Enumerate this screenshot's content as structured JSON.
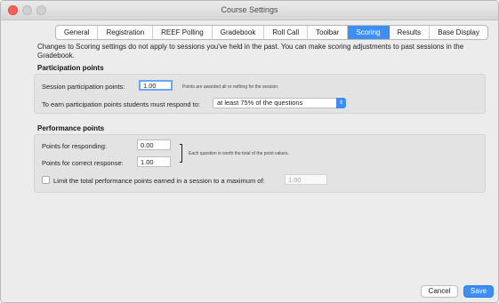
{
  "window": {
    "title": "Course Settings"
  },
  "tabs": [
    {
      "label": "General"
    },
    {
      "label": "Registration"
    },
    {
      "label": "REEF Polling"
    },
    {
      "label": "Gradebook"
    },
    {
      "label": "Roll Call"
    },
    {
      "label": "Toolbar"
    },
    {
      "label": "Scoring",
      "active": true
    },
    {
      "label": "Results"
    },
    {
      "label": "Base Display"
    }
  ],
  "notice": "Changes to Scoring settings do not apply to sessions you've held in the past. You can make scoring adjustments to past sessions in the Gradebook.",
  "participation": {
    "heading": "Participation points",
    "session_label": "Session participation points:",
    "session_value": "1.00",
    "session_hint": "Points are awarded all or nothing for the session.",
    "earn_label": "To earn participation points students must respond to:",
    "earn_selected": "at least 75% of the questions"
  },
  "performance": {
    "heading": "Performance points",
    "responding_label": "Points for responding:",
    "responding_value": "0.00",
    "correct_label": "Points for correct response:",
    "correct_value": "1.00",
    "hint": "Each question is worth the total of the point values.",
    "limit_label": "Limit the total performance points earned in a session to a maximum of:",
    "limit_value": "1.00",
    "limit_checked": false
  },
  "footer": {
    "cancel_label": "Cancel",
    "save_label": "Save"
  },
  "colors": {
    "accent": "#3d8ff6",
    "close": "#fc5f57"
  }
}
